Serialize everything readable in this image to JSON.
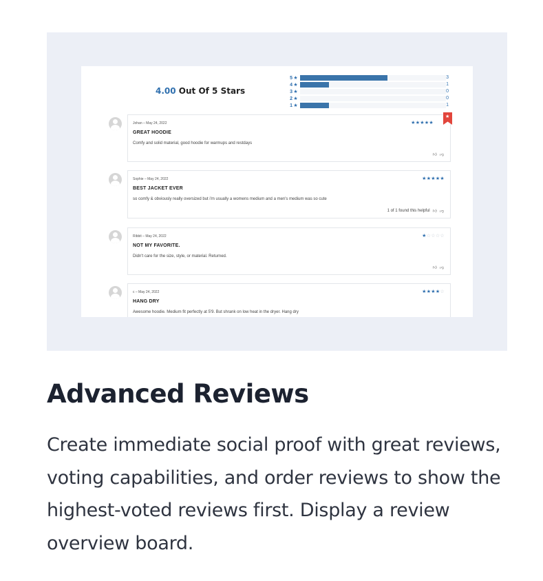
{
  "summary": {
    "average": "4.00",
    "suffix": "Out Of 5 Stars"
  },
  "rating_breakdown": [
    {
      "label": "5",
      "count": "3",
      "fraction": 0.6
    },
    {
      "label": "4",
      "count": "1",
      "fraction": 0.2
    },
    {
      "label": "3",
      "count": "0",
      "fraction": 0
    },
    {
      "label": "2",
      "count": "0",
      "fraction": 0
    },
    {
      "label": "1",
      "count": "1",
      "fraction": 0.2
    }
  ],
  "star_glyph": "★",
  "reviews": [
    {
      "meta": "Johan – May 24, 2022",
      "title": "GREAT HOODIE",
      "text": "Comfy and solid material, good hoodie for warmups and restdays",
      "rating": 5,
      "helpful": "",
      "featured": true
    },
    {
      "meta": "Sophie – May 24, 2022",
      "title": "BEST JACKET EVER",
      "text": "so comfy & obviously really oversized but i'm usually a womens medium and a men's medium was so cute",
      "rating": 5,
      "helpful": "1 of 1 found this helpful",
      "featured": false
    },
    {
      "meta": "Ribbit – May 24, 2022",
      "title": "NOT MY FAVORITE.",
      "text": "Didn't care for the size, style, or material. Returned.",
      "rating": 1,
      "helpful": "",
      "featured": false
    },
    {
      "meta": "c – May 24, 2022",
      "title": "HANG DRY",
      "text": "Awesome hoodie. Medium fit perfectly at 5'9. But shrank on low heat in the dryer. Hang dry",
      "rating": 4,
      "helpful": "",
      "featured": false
    }
  ],
  "feature": {
    "title": "Advanced Reviews",
    "description": "Create immediate social proof with great reviews, voting capabilities, and order reviews to show the highest-voted reviews first. Display a review overview board."
  },
  "colors": {
    "accent": "#2f6fae",
    "bar": "#3a74aa",
    "ribbon": "#e2453c",
    "hero_bg": "#eceff6"
  }
}
